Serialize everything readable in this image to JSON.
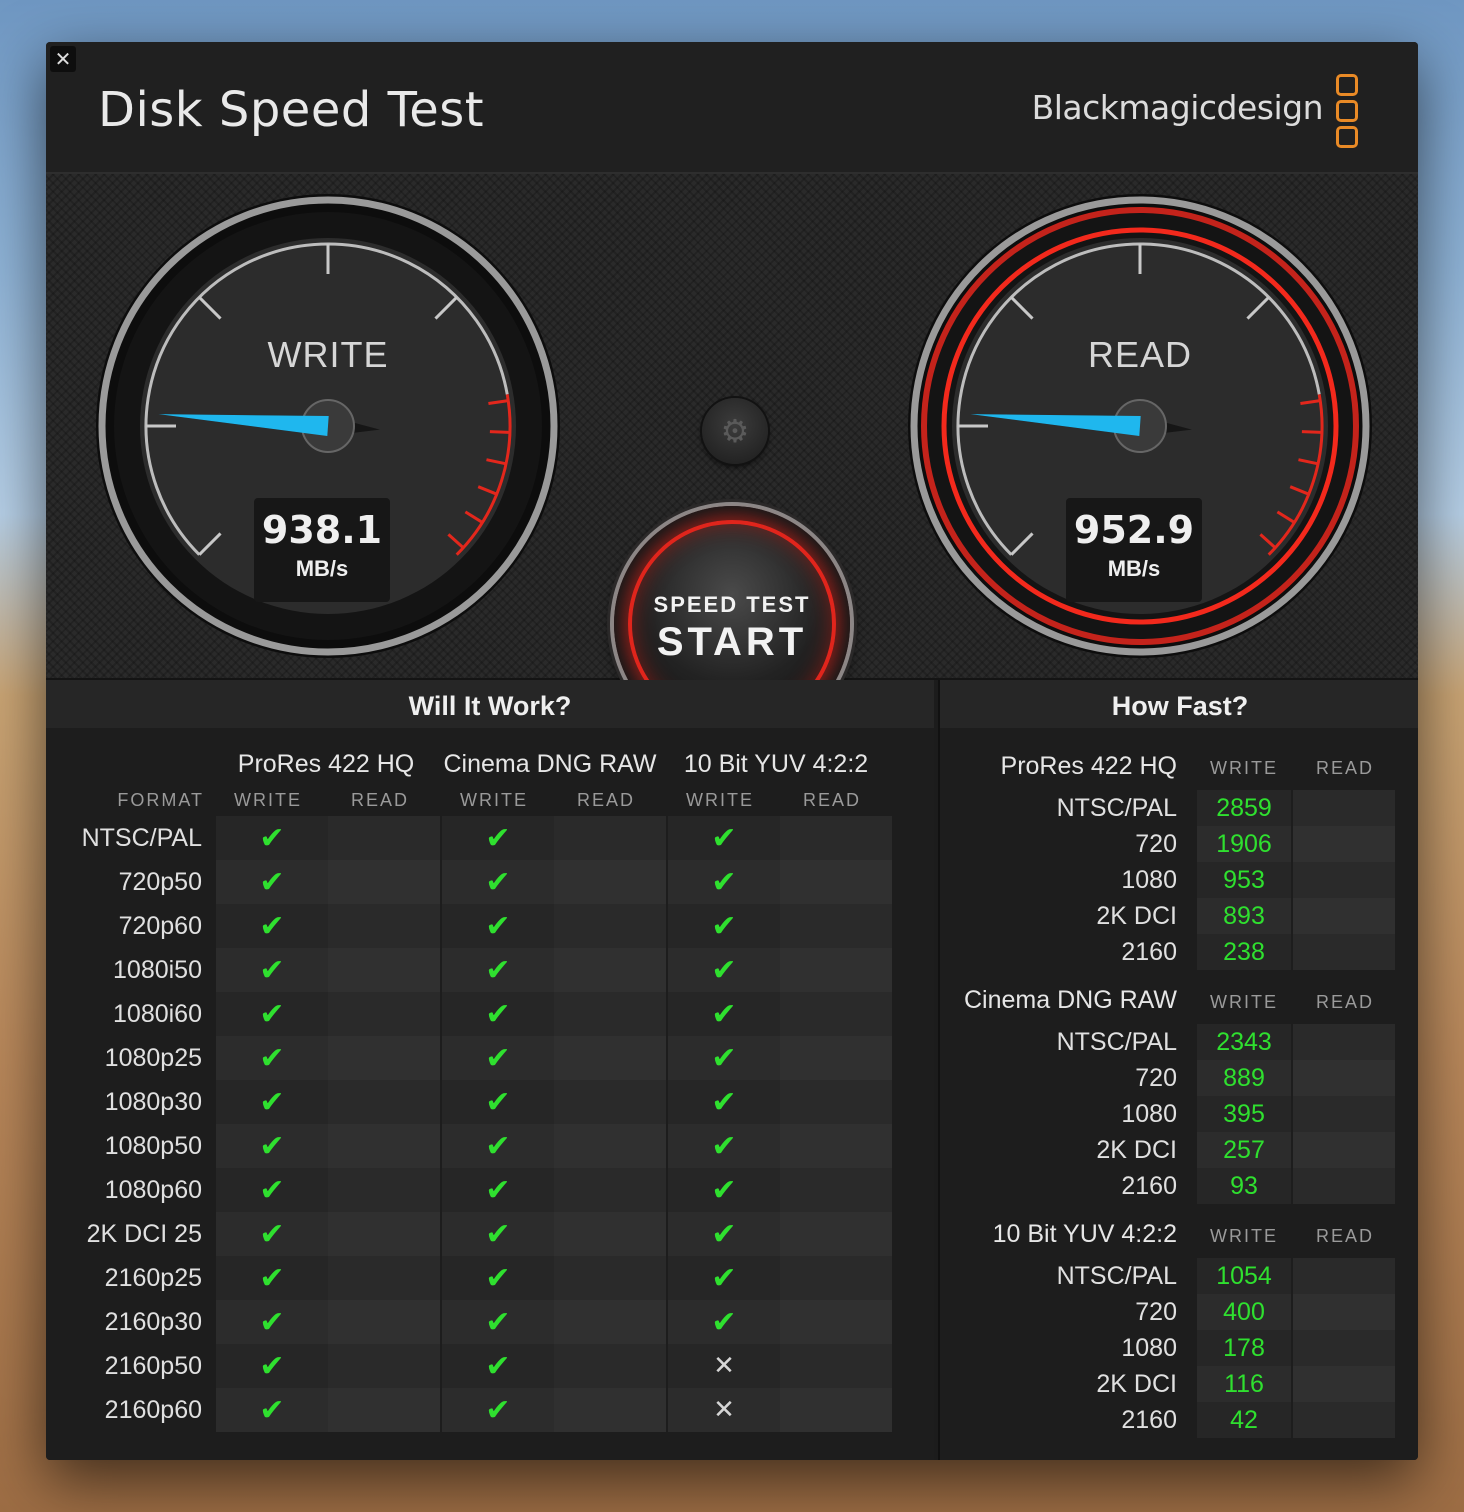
{
  "window": {
    "title": "Disk Speed Test",
    "brand": "Blackmagicdesign",
    "close_icon": "✕"
  },
  "colors": {
    "accent_red": "#e0251c",
    "needle": "#1fb7ee",
    "check": "#2fe02f",
    "logo": "#e98a26"
  },
  "gauges": {
    "write": {
      "label": "WRITE",
      "value": "938.1",
      "unit": "MB/s"
    },
    "read": {
      "label": "READ",
      "value": "952.9",
      "unit": "MB/s"
    }
  },
  "controls": {
    "settings_icon": "⚙",
    "start_top": "SPEED TEST",
    "start_main": "START"
  },
  "will_it_work": {
    "title": "Will It Work?",
    "format_header": "FORMAT",
    "write_header": "WRITE",
    "read_header": "READ",
    "groups": [
      "ProRes 422 HQ",
      "Cinema DNG RAW",
      "10 Bit YUV 4:2:2"
    ],
    "rows": [
      {
        "format": "NTSC/PAL",
        "w": [
          "✔",
          "✔",
          "✔"
        ]
      },
      {
        "format": "720p50",
        "w": [
          "✔",
          "✔",
          "✔"
        ]
      },
      {
        "format": "720p60",
        "w": [
          "✔",
          "✔",
          "✔"
        ]
      },
      {
        "format": "1080i50",
        "w": [
          "✔",
          "✔",
          "✔"
        ]
      },
      {
        "format": "1080i60",
        "w": [
          "✔",
          "✔",
          "✔"
        ]
      },
      {
        "format": "1080p25",
        "w": [
          "✔",
          "✔",
          "✔"
        ]
      },
      {
        "format": "1080p30",
        "w": [
          "✔",
          "✔",
          "✔"
        ]
      },
      {
        "format": "1080p50",
        "w": [
          "✔",
          "✔",
          "✔"
        ]
      },
      {
        "format": "1080p60",
        "w": [
          "✔",
          "✔",
          "✔"
        ]
      },
      {
        "format": "2K DCI 25",
        "w": [
          "✔",
          "✔",
          "✔"
        ]
      },
      {
        "format": "2160p25",
        "w": [
          "✔",
          "✔",
          "✔"
        ]
      },
      {
        "format": "2160p30",
        "w": [
          "✔",
          "✔",
          "✔"
        ]
      },
      {
        "format": "2160p50",
        "w": [
          "✔",
          "✔",
          "✕"
        ]
      },
      {
        "format": "2160p60",
        "w": [
          "✔",
          "✔",
          "✕"
        ]
      }
    ]
  },
  "how_fast": {
    "title": "How Fast?",
    "write_header": "WRITE",
    "read_header": "READ",
    "groups": [
      {
        "name": "ProRes 422 HQ",
        "rows": [
          {
            "label": "NTSC/PAL",
            "write": "2859"
          },
          {
            "label": "720",
            "write": "1906"
          },
          {
            "label": "1080",
            "write": "953"
          },
          {
            "label": "2K DCI",
            "write": "893"
          },
          {
            "label": "2160",
            "write": "238"
          }
        ]
      },
      {
        "name": "Cinema DNG RAW",
        "rows": [
          {
            "label": "NTSC/PAL",
            "write": "2343"
          },
          {
            "label": "720",
            "write": "889"
          },
          {
            "label": "1080",
            "write": "395"
          },
          {
            "label": "2K DCI",
            "write": "257"
          },
          {
            "label": "2160",
            "write": "93"
          }
        ]
      },
      {
        "name": "10 Bit YUV 4:2:2",
        "rows": [
          {
            "label": "NTSC/PAL",
            "write": "1054"
          },
          {
            "label": "720",
            "write": "400"
          },
          {
            "label": "1080",
            "write": "178"
          },
          {
            "label": "2K DCI",
            "write": "116"
          },
          {
            "label": "2160",
            "write": "42"
          }
        ]
      }
    ]
  }
}
